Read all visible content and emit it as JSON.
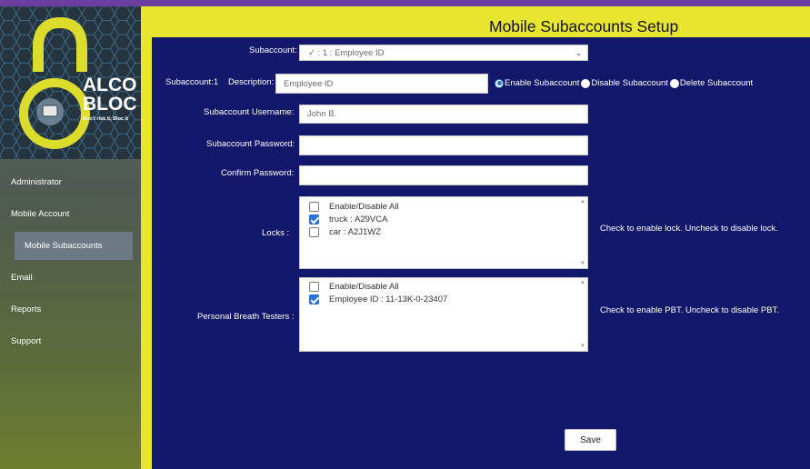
{
  "brand": {
    "name_line1": "ALCO",
    "name_line2": "BLOC",
    "tagline": "Don't risk it, Bloc it",
    "top_accent_color": "#6a3fa0",
    "accent_yellow": "#e7e52f",
    "panel_navy": "#13186b"
  },
  "sidebar": {
    "items": [
      {
        "label": "Administrator",
        "active": false
      },
      {
        "label": "Mobile Account",
        "active": false
      },
      {
        "label": "Mobile Subaccounts",
        "active": true
      },
      {
        "label": "Email",
        "active": false
      },
      {
        "label": "Reports",
        "active": false
      },
      {
        "label": "Support",
        "active": false
      }
    ]
  },
  "header": {
    "title": "Mobile Subaccounts Setup"
  },
  "form": {
    "subaccount_label": "Subaccount:",
    "subaccount_value": "✓ : 1 : Employee ID",
    "subaccount_id_label": "Subaccount:1",
    "description_label": "Description:",
    "description_value": "Employee ID",
    "radios": [
      {
        "label": "Enable Subaccount",
        "selected": true
      },
      {
        "label": "Disable Subaccount",
        "selected": false
      },
      {
        "label": "Delete Subaccount",
        "selected": false
      }
    ],
    "username_label": "Subaccount Username:",
    "username_value": "John B.",
    "password_label": "Subaccount Password:",
    "password_value": "",
    "confirm_label": "Confirm Password:",
    "confirm_value": "",
    "locks_label": "Locks :",
    "locks_items": [
      {
        "label": "Enable/Disable All",
        "checked": false
      },
      {
        "label": "truck : A29VCA",
        "checked": true
      },
      {
        "label": "car : A2J1WZ",
        "checked": false
      }
    ],
    "locks_hint": "Check to enable lock. Uncheck to disable lock.",
    "pbt_label": "Personal Breath Testers :",
    "pbt_items": [
      {
        "label": "Enable/Disable All",
        "checked": false
      },
      {
        "label": "Employee ID : 11-13K-0-23407",
        "checked": true
      }
    ],
    "pbt_hint": "Check to enable PBT. Uncheck to disable PBT.",
    "save_label": "Save"
  }
}
